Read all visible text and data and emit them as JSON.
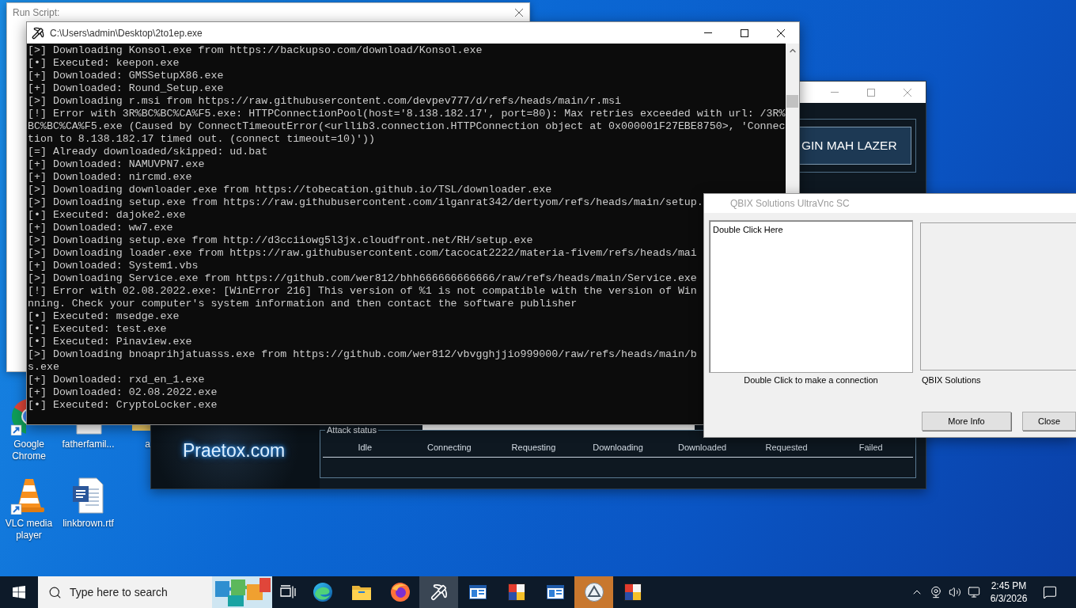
{
  "desktop_icons": [
    {
      "kind": "chrome",
      "label": "Google Chrome"
    },
    {
      "kind": "document",
      "label": "fatherfamil..."
    },
    {
      "kind": "folder",
      "label": "a"
    },
    {
      "kind": "vlc",
      "label": "VLC media player"
    },
    {
      "kind": "word",
      "label": "linkbrown.rtf"
    }
  ],
  "run_script_window": {
    "title": "Run Script:"
  },
  "praetox_window": {
    "button": "GIN MAH LAZER",
    "logo": "Praetox.com",
    "attack_status": {
      "title": "Attack status",
      "columns": [
        "Idle",
        "Connecting",
        "Requesting",
        "Downloading",
        "Downloaded",
        "Requested",
        "Failed"
      ]
    }
  },
  "console_window": {
    "title": "C:\\Users\\admin\\Desktop\\2to1ep.exe",
    "lines": [
      "[>] Downloading Konsol.exe from https://backupso.com/download/Konsol.exe",
      "[•] Executed: keepon.exe",
      "[+] Downloaded: GMSSetupX86.exe",
      "[+] Downloaded: Round_Setup.exe",
      "[>] Downloading r.msi from https://raw.githubusercontent.com/devpev777/d/refs/heads/main/r.msi",
      "[!] Error with 3R%BC%BC%CA%F5.exe: HTTPConnectionPool(host='8.138.182.17', port=80): Max retries exceeded with url: /3R%",
      "BC%BC%CA%F5.exe (Caused by ConnectTimeoutError(<urllib3.connection.HTTPConnection object at 0x000001F27EBE8750>, 'Connec",
      "tion to 8.138.182.17 timed out. (connect timeout=10)'))",
      "[=] Already downloaded/skipped: ud.bat",
      "[+] Downloaded: NAMUVPN7.exe",
      "[+] Downloaded: nircmd.exe",
      "[>] Downloading downloader.exe from https://tobecation.github.io/TSL/downloader.exe",
      "[>] Downloading setup.exe from https://raw.githubusercontent.com/ilganrat342/dertyom/refs/heads/main/setup.",
      "[•] Executed: dajoke2.exe",
      "[+] Downloaded: ww7.exe",
      "[>] Downloading setup.exe from http://d3cciiowg5l3jx.cloudfront.net/RH/setup.exe",
      "[>] Downloading loader.exe from https://raw.githubusercontent.com/tacocat2222/materia-fivem/refs/heads/mai",
      "[+] Downloaded: System1.vbs",
      "[>] Downloading Service.exe from https://github.com/wer812/bhh666666666666/raw/refs/heads/main/Service.exe",
      "[!] Error with 02.08.2022.exe: [WinError 216] This version of %1 is not compatible with the version of Win",
      "nning. Check your computer's system information and then contact the software publisher",
      "[•] Executed: msedge.exe",
      "[•] Executed: test.exe",
      "[•] Executed: Pinaview.exe",
      "[>] Downloading bnoaprihjatuasss.exe from https://github.com/wer812/vbvgghjjio999000/raw/refs/heads/main/b",
      "s.exe",
      "[+] Downloaded: rxd_en_1.exe",
      "[+] Downloaded: 02.08.2022.exe",
      "[•] Executed: CryptoLocker.exe"
    ]
  },
  "qbix_window": {
    "title": "QBIX Solutions UltraVnc SC",
    "list_items": [
      "Double Click Here"
    ],
    "list_caption": "Double Click to make a connection",
    "panel_caption": "QBIX Solutions",
    "buttons": [
      "More Info",
      "Close"
    ]
  },
  "taskbar": {
    "search": {
      "placeholder": "Type here to search"
    },
    "apps": [
      {
        "kind": "edge",
        "selected": false,
        "flashing": false
      },
      {
        "kind": "folder",
        "selected": false,
        "flashing": false
      },
      {
        "kind": "firefox",
        "selected": false,
        "flashing": false
      },
      {
        "kind": "pickaxe",
        "selected": true,
        "flashing": false
      },
      {
        "kind": "window",
        "selected": false,
        "flashing": false
      },
      {
        "kind": "tiles",
        "selected": false,
        "flashing": false
      },
      {
        "kind": "window",
        "selected": false,
        "flashing": false
      },
      {
        "kind": "circle",
        "selected": false,
        "flashing": true
      },
      {
        "kind": "tiles",
        "selected": false,
        "flashing": false
      }
    ],
    "clock": {
      "time": "2:45 PM",
      "date": "6/3/2026"
    }
  }
}
